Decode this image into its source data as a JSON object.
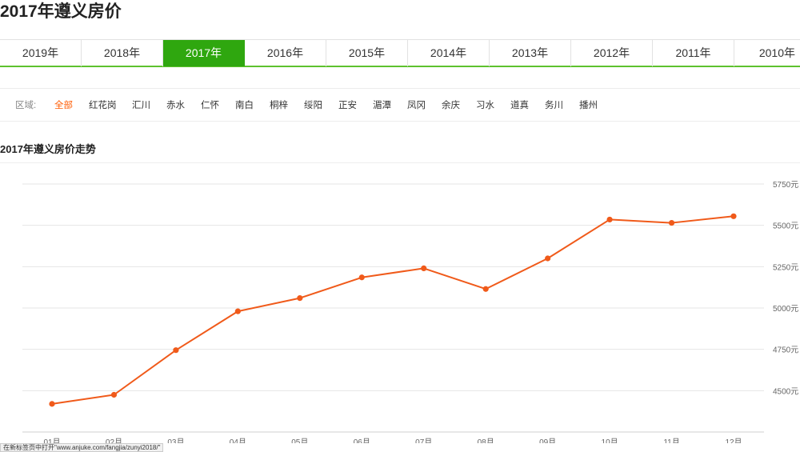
{
  "page": {
    "title": "2017年遵义房价"
  },
  "year_tabs": [
    {
      "label": "2019年",
      "active": false
    },
    {
      "label": "2018年",
      "active": false
    },
    {
      "label": "2017年",
      "active": true
    },
    {
      "label": "2016年",
      "active": false
    },
    {
      "label": "2015年",
      "active": false
    },
    {
      "label": "2014年",
      "active": false
    },
    {
      "label": "2013年",
      "active": false
    },
    {
      "label": "2012年",
      "active": false
    },
    {
      "label": "2011年",
      "active": false
    },
    {
      "label": "2010年",
      "active": false
    }
  ],
  "regions": {
    "label": "区域:",
    "items": [
      {
        "label": "全部",
        "active": true
      },
      {
        "label": "红花岗",
        "active": false
      },
      {
        "label": "汇川",
        "active": false
      },
      {
        "label": "赤水",
        "active": false
      },
      {
        "label": "仁怀",
        "active": false
      },
      {
        "label": "南白",
        "active": false
      },
      {
        "label": "桐梓",
        "active": false
      },
      {
        "label": "绥阳",
        "active": false
      },
      {
        "label": "正安",
        "active": false
      },
      {
        "label": "湄潭",
        "active": false
      },
      {
        "label": "凤冈",
        "active": false
      },
      {
        "label": "余庆",
        "active": false
      },
      {
        "label": "习水",
        "active": false
      },
      {
        "label": "道真",
        "active": false
      },
      {
        "label": "务川",
        "active": false
      },
      {
        "label": "播州",
        "active": false
      }
    ],
    "active_color": "#ff5a00"
  },
  "colors": {
    "accent": "#2fa70f",
    "line": "#f05a1a"
  },
  "status_tip": "在新标签页中打开\"www.anjuke.com/fangjia/zunyi2018/\"",
  "chart_data": {
    "type": "line",
    "title": "2017年遵义房价走势",
    "categories": [
      "01月",
      "02月",
      "03月",
      "04月",
      "05月",
      "06月",
      "07月",
      "08月",
      "09月",
      "10月",
      "11月",
      "12月"
    ],
    "series": [
      {
        "values": [
          4420,
          4475,
          4745,
          4980,
          5060,
          5185,
          5240,
          5115,
          5300,
          5535,
          5515,
          5555
        ]
      }
    ],
    "y_ticks": [
      "4500元",
      "4750元",
      "5000元",
      "5250元",
      "5500元",
      "5750元"
    ],
    "y_tick_values": [
      4500,
      4750,
      5000,
      5250,
      5500,
      5750
    ],
    "ylim": [
      4250,
      5750
    ],
    "grid": true,
    "y_axis_position": "right"
  }
}
